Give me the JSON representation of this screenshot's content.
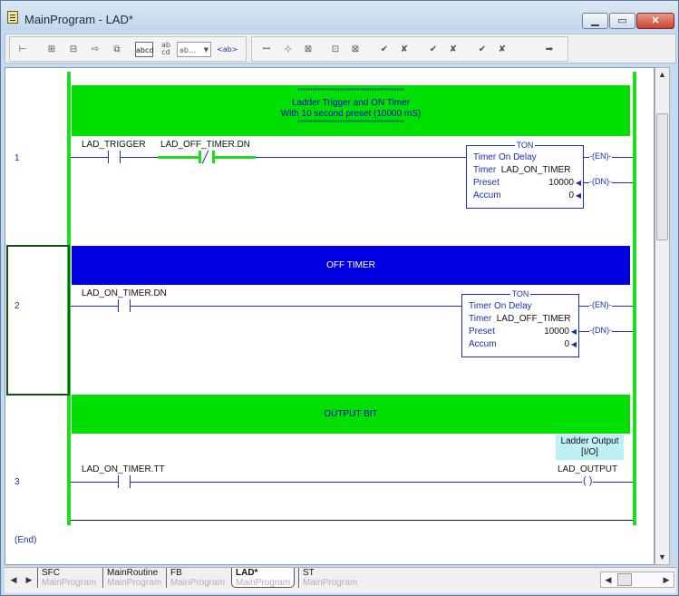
{
  "window": {
    "title": "MainProgram - LAD*",
    "min_label": "▁",
    "max_label": "▭",
    "close_label": "✕"
  },
  "toolbar": {
    "tools": [
      "add-rung-icon",
      "branch-icon",
      "branch-level-icon",
      "move-icon",
      "copy-icon",
      "show-comments-icon",
      "show-descriptions-icon",
      "rung-comment-icon",
      "zoom-icon",
      "xic-icon",
      "xio-icon",
      "ote-icon",
      "otl-icon",
      "otu-icon",
      "edit-accept-icon",
      "edit-cancel-icon",
      "test-accept-icon",
      "test-cancel-icon",
      "finalize-icon",
      "go-to-icon"
    ],
    "comment_toggle": "abcd",
    "description_toggle": "ab\ncd",
    "zoom_select": "ab...",
    "tag_mode": "<ab>"
  },
  "rungs": [
    {
      "number": "1",
      "comment_lines": [
        "*******************************************",
        "Ladder Trigger and ON Timer",
        "With 10 second preset (10000 mS)",
        "*******************************************"
      ],
      "contact1_tag": "LAD_TRIGGER",
      "contact2_tag": "LAD_OFF_TIMER.DN",
      "ton": {
        "header": "TON",
        "title": "Timer On Delay",
        "timer_label": "Timer",
        "timer_tag": "LAD_ON_TIMER",
        "preset_label": "Preset",
        "preset_value": "10000",
        "accum_label": "Accum",
        "accum_value": "0",
        "en_pin": "EN",
        "dn_pin": "DN"
      }
    },
    {
      "number": "2",
      "comment": "OFF TIMER",
      "contact_tag": "LAD_ON_TIMER.DN",
      "ton": {
        "header": "TON",
        "title": "Timer On Delay",
        "timer_label": "Timer",
        "timer_tag": "LAD_OFF_TIMER",
        "preset_label": "Preset",
        "preset_value": "10000",
        "accum_label": "Accum",
        "accum_value": "0",
        "en_pin": "EN",
        "dn_pin": "DN"
      }
    },
    {
      "number": "3",
      "comment": "OUTPUT BIT",
      "contact_tag": "LAD_ON_TIMER.TT",
      "output_description": [
        "Ladder Output",
        "[I/O]"
      ],
      "output_tag": "LAD_OUTPUT"
    }
  ],
  "end_label": "(End)",
  "tabs": [
    {
      "name": "SFC",
      "sub": "MainProgram"
    },
    {
      "name": "MainRoutine",
      "sub": "MainProgram"
    },
    {
      "name": "FB",
      "sub": "MainProgram"
    },
    {
      "name": "LAD*",
      "sub": "MainProgram"
    },
    {
      "name": "ST",
      "sub": "MainProgram"
    }
  ],
  "colors": {
    "rail_green": "#1fdc1f",
    "comment_green": "#00e000",
    "comment_blue": "#0000e0",
    "wire_blue": "#1a2eb5"
  }
}
